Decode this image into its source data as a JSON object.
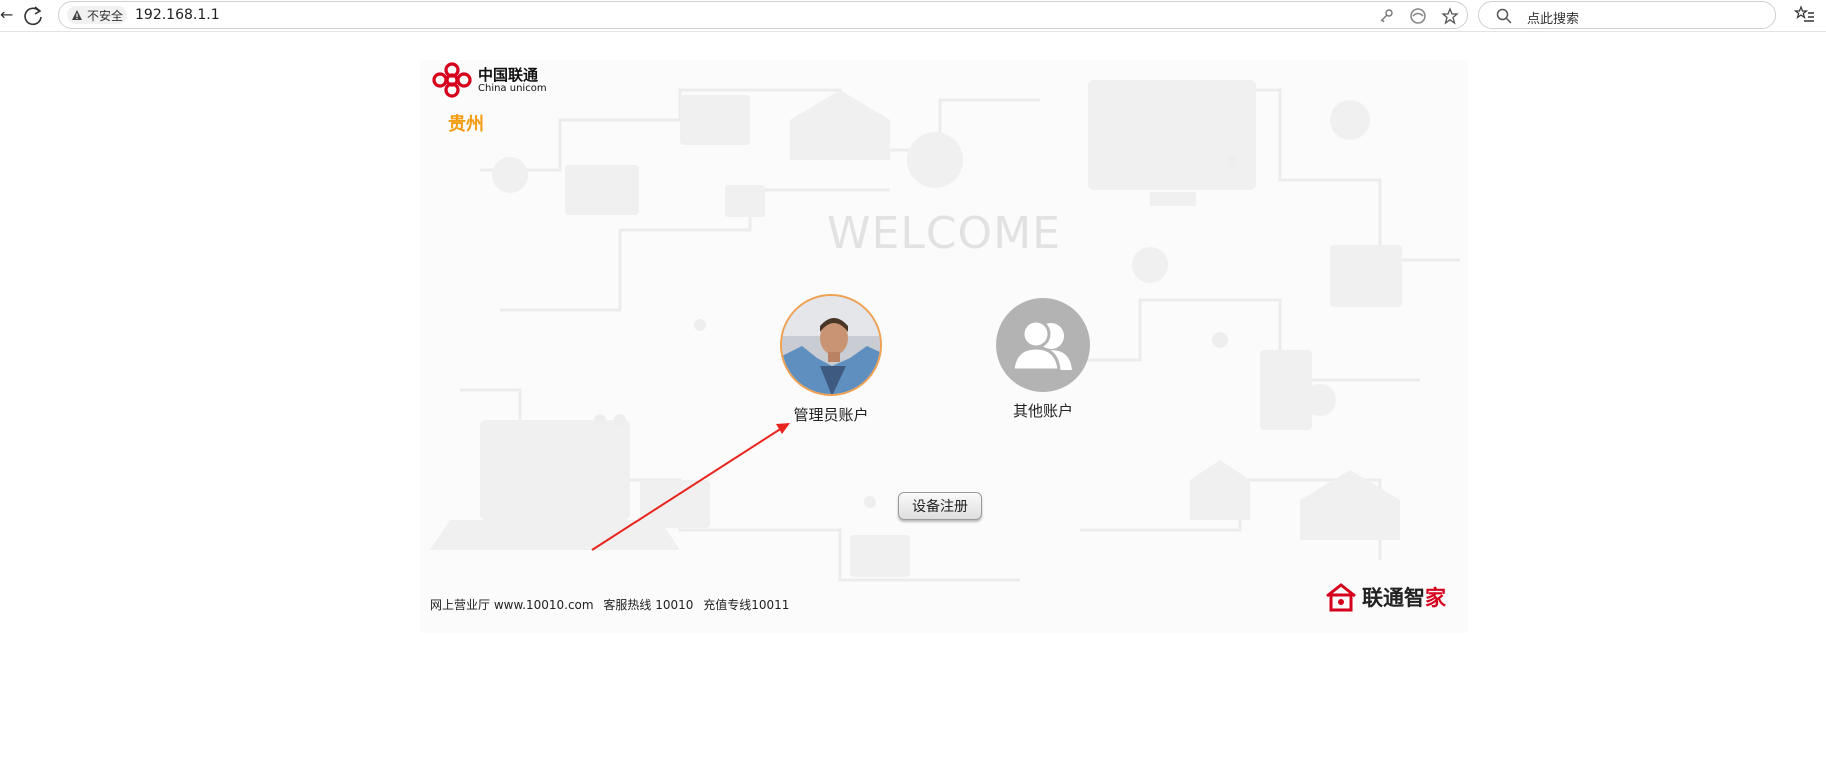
{
  "browser": {
    "security_label": "不安全",
    "url": "192.168.1.1",
    "search_placeholder": "点此搜索"
  },
  "page": {
    "logo": {
      "cn": "中国联通",
      "en": "China unicom"
    },
    "region": "贵州",
    "welcome": "WELCOME",
    "accounts": [
      {
        "label": "管理员账户"
      },
      {
        "label": "其他账户"
      }
    ],
    "register_button": "设备注册",
    "footer": {
      "hall": "网上营业厅 www.10010.com",
      "hotline": "客服热线   10010",
      "recharge": "充值专线10011"
    },
    "brand": {
      "text_a": "联通智",
      "text_b": "家"
    }
  },
  "colors": {
    "accent": "#f39c12",
    "brand_red": "#d6001c",
    "annotation_arrow": "#e8251e"
  }
}
